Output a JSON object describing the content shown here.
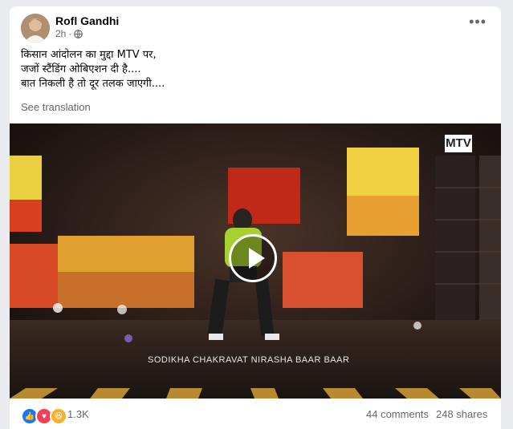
{
  "post": {
    "author": "Rofl Gandhi",
    "time": "2h",
    "privacy_icon": "globe-icon",
    "lines": [
      "किसान आंदोलन का मुद्दा MTV पर,",
      "जजों स्टैंडिंग ओबिएशन दी है....",
      "बात निकली है तो दूर तलक जाएगी...."
    ],
    "see_translation": "See translation",
    "more_icon": "•••"
  },
  "video": {
    "logo": "MTV",
    "caption": "SODIKHA CHAKRAVAT NIRASHA BAAR BAAR"
  },
  "footer": {
    "reactions": [
      "like-icon",
      "love-icon",
      "haha-icon"
    ],
    "reaction_count": "1.3K",
    "comments": "44 comments",
    "shares": "248 shares"
  },
  "colors": {
    "background": "#e9ebee",
    "card": "#ffffff",
    "secondary_text": "#65676b",
    "like_blue": "#1877f2",
    "love_red": "#f33e58",
    "haha_yellow": "#f7b125"
  }
}
